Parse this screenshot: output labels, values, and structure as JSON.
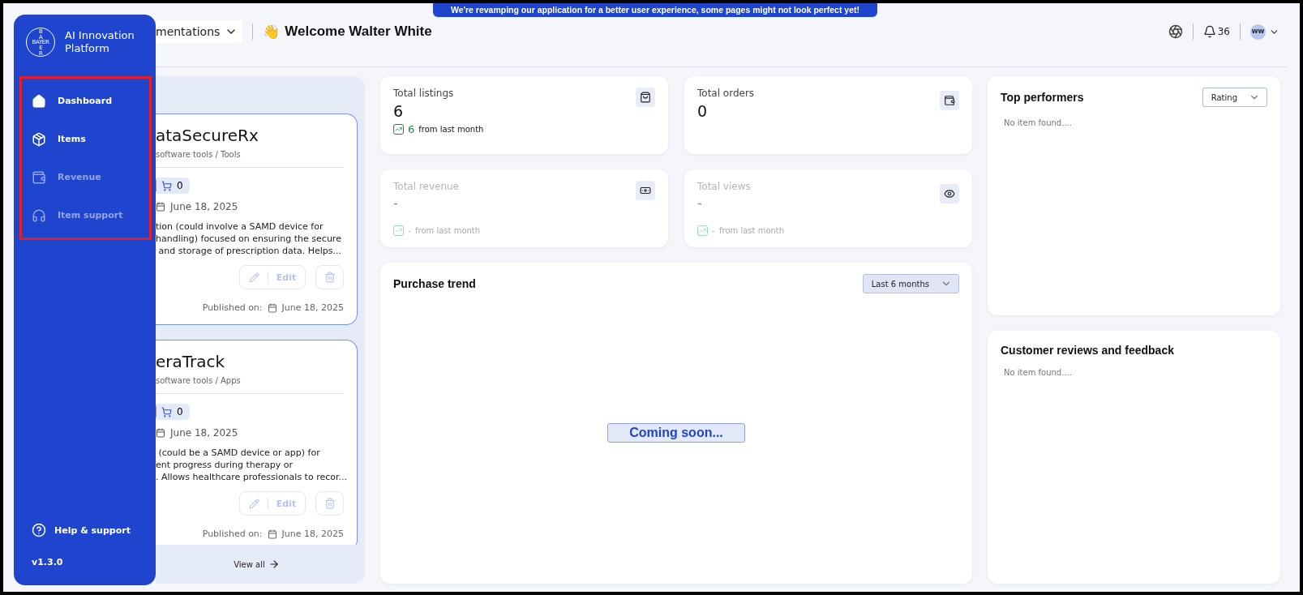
{
  "banner": "We're revamping our application for a better user experience, some pages might not look perfect yet!",
  "sidebar": {
    "logo": {
      "horizontal": "BAYER",
      "vertical_top": "BA",
      "vertical_bottom": "ER"
    },
    "title": "AI Innovation Platform",
    "nav_highlighted": true,
    "items": [
      {
        "label": "Dashboard",
        "kind": "home",
        "selected": true,
        "disabled": false
      },
      {
        "label": "Items",
        "kind": "items",
        "selected": false,
        "disabled": false
      },
      {
        "label": "Revenue",
        "kind": "revenue",
        "selected": false,
        "disabled": true
      },
      {
        "label": "Item support",
        "kind": "support",
        "selected": false,
        "disabled": true
      }
    ],
    "help": "Help & support",
    "version": "v1.3.0"
  },
  "header": {
    "dropdown": "mentations",
    "wave_emoji": "👋",
    "welcome": "Welcome Walter White",
    "notifications": "36",
    "avatar": "WW"
  },
  "listings": {
    "cards": [
      {
        "title": "ataSecureRx",
        "path": "software tools / Tools",
        "cart_count": "0",
        "date": "June 18, 2025",
        "description": "tion (could involve a SAMD device for\nhandling) focused on ensuring the secure\n and storage of prescription data. Helps...",
        "edit": "Edit",
        "published_label": "Published on:",
        "published_date": "June 18, 2025"
      },
      {
        "title": "eraTrack",
        "path": "software tools / Apps",
        "cart_count": "0",
        "date": "June 18, 2025",
        "description": " (could be a SAMD device or app) for\nent progress during therapy or\n. Allows healthcare professionals to recor...",
        "edit": "Edit",
        "published_label": "Published on:",
        "published_date": "June 18, 2025"
      }
    ],
    "view_all": "View all"
  },
  "stats": [
    {
      "title": "Total listings",
      "kind": "bag",
      "value": "6",
      "change": "6",
      "change_suffix": "from last month",
      "muted": false
    },
    {
      "title": "Total orders",
      "kind": "wallet",
      "value": "0",
      "muted": false
    },
    {
      "title": "Total revenue",
      "kind": "cash",
      "value": "-",
      "change": "-",
      "change_suffix": "from last month",
      "muted": true
    },
    {
      "title": "Total views",
      "kind": "eye",
      "value": "-",
      "change": "-",
      "change_suffix": "from last month",
      "muted": true
    }
  ],
  "purchase_trend": {
    "title": "Purchase trend",
    "range": "Last 6 months",
    "message": "Coming soon..."
  },
  "top_performers": {
    "title": "Top performers",
    "sort": "Rating",
    "empty": "No item found...."
  },
  "reviews": {
    "title": "Customer reviews and feedback",
    "empty": "No item found...."
  }
}
